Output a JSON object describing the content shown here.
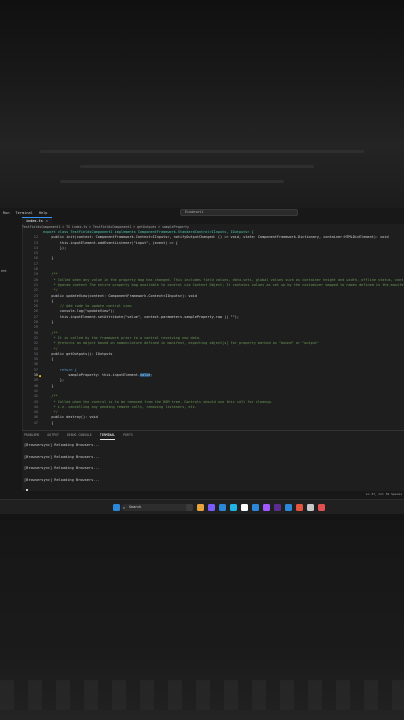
{
  "titlebar": {
    "menu": [
      "Run",
      "Terminal",
      "Help"
    ],
    "search_text": "Ecodeset1"
  },
  "tab": {
    "label": "index.ts",
    "close": "×"
  },
  "breadcrumb": "TestFieldsComponent1 > TS index.ts > TestFieldsComponent1 > getOutputs > sampleProperty",
  "sidebar_label": "ent",
  "editor": {
    "lines": [
      {
        "n": "",
        "t": "export class TestFieldsComponent1 implements ComponentFramework.StandardControl<IInputs, IOutputs> {",
        "c": "ty"
      },
      {
        "n": "12",
        "t": "    public init(context: ComponentFramework.Context<IInputs>, notifyOutputChanged: () => void, state: ComponentFramework.Dictionary, container:HTMLDivElement): void",
        "c": "code"
      },
      {
        "n": "13",
        "t": "        this.inputElement.addEventListener(\"input\", (event) => {",
        "c": "code"
      },
      {
        "n": "14",
        "t": "        });",
        "c": "code"
      },
      {
        "n": "15",
        "t": "",
        "c": "code"
      },
      {
        "n": "16",
        "t": "    }",
        "c": "code"
      },
      {
        "n": "17",
        "t": "",
        "c": "code"
      },
      {
        "n": "18",
        "t": "",
        "c": "code"
      },
      {
        "n": "19",
        "t": "    /**",
        "c": "cm"
      },
      {
        "n": "20",
        "t": "     * Called when any value in the property bag has changed. This includes field values, data-sets, global values such as container height and width, offline status, control",
        "c": "cm"
      },
      {
        "n": "21",
        "t": "     * @param context The entire property bag available to control via Context Object; It contains values as set up by the customizer mapped to names defined in the manifest",
        "c": "cm"
      },
      {
        "n": "22",
        "t": "     */",
        "c": "cm"
      },
      {
        "n": "23",
        "t": "    public updateView(context: ComponentFramework.Context<IInputs>): void",
        "c": "code"
      },
      {
        "n": "24",
        "t": "    {",
        "c": "code"
      },
      {
        "n": "25",
        "t": "        // Add code to update control view",
        "c": "cm"
      },
      {
        "n": "26",
        "t": "        console.log(\"updateView\");",
        "c": "code"
      },
      {
        "n": "27",
        "t": "        this.inputElement.setAttribute(\"value\", context.parameters.sampleProperty.raw || \"\");",
        "c": "code"
      },
      {
        "n": "28",
        "t": "    }",
        "c": "code"
      },
      {
        "n": "29",
        "t": "",
        "c": "code"
      },
      {
        "n": "30",
        "t": "    /**",
        "c": "cm"
      },
      {
        "n": "31",
        "t": "     * It is called by the framework prior to a control receiving new data.",
        "c": "cm"
      },
      {
        "n": "32",
        "t": "     * @returns an object based on nomenclature defined in manifest, expecting object[s] for property marked as \"bound\" or \"output\"",
        "c": "cm"
      },
      {
        "n": "33",
        "t": "     */",
        "c": "cm"
      },
      {
        "n": "34",
        "t": "    public getOutputs(): IOutputs",
        "c": "code"
      },
      {
        "n": "35",
        "t": "    {",
        "c": "code"
      },
      {
        "n": "36",
        "t": "",
        "c": "code"
      },
      {
        "n": "37",
        "t": "        return {",
        "c": "kw"
      },
      {
        "n": "38",
        "t": "            sampleProperty: this.inputElement.",
        "c": "code",
        "sel": "value",
        "active": true
      },
      {
        "n": "39",
        "t": "        };",
        "c": "code"
      },
      {
        "n": "40",
        "t": "    }",
        "c": "code"
      },
      {
        "n": "41",
        "t": "",
        "c": "code"
      },
      {
        "n": "42",
        "t": "    /**",
        "c": "cm"
      },
      {
        "n": "43",
        "t": "     * Called when the control is to be removed from the DOM tree. Controls should use this call for cleanup.",
        "c": "cm"
      },
      {
        "n": "44",
        "t": "     * i.e. cancelling any pending remote calls, removing listeners, etc.",
        "c": "cm"
      },
      {
        "n": "45",
        "t": "     */",
        "c": "cm"
      },
      {
        "n": "46",
        "t": "    public destroy(): void",
        "c": "code"
      },
      {
        "n": "47",
        "t": "    {",
        "c": "code"
      }
    ]
  },
  "panel": {
    "tabs": [
      "PROBLEMS",
      "OUTPUT",
      "DEBUG CONSOLE",
      "TERMINAL",
      "PORTS"
    ],
    "active_tab": "TERMINAL",
    "terminal_lines": [
      "[Browsersync] Reloading Browsers...",
      "[Browsersync] Reloading Browsers...",
      "[Browsersync] Reloading Browsers...",
      "[Browsersync] Reloading Browsers..."
    ]
  },
  "statusbar": {
    "right": "Ln 37, Col 52   Spaces"
  },
  "taskbar": {
    "search_placeholder": "Search",
    "icon_colors": [
      "#2b88d8",
      "#3a3a3a",
      "#e8a33d",
      "#7a5cff",
      "#2b88d8",
      "#1fb4e6",
      "#ffffff",
      "#2b88d8",
      "#a259ff",
      "#5c2d91",
      "#2b88d8",
      "#e3553e",
      "#c7c7c7",
      "#e05050"
    ],
    "icon_names": [
      "windows-icon",
      "task-view-icon",
      "file-explorer-icon",
      "teams-icon",
      "mail-icon",
      "edge-icon",
      "chrome-icon",
      "store-icon",
      "visual-studio-icon",
      "vs-icon",
      "vscode-icon",
      "powerapps-icon",
      "app-icon",
      "brave-icon"
    ]
  }
}
